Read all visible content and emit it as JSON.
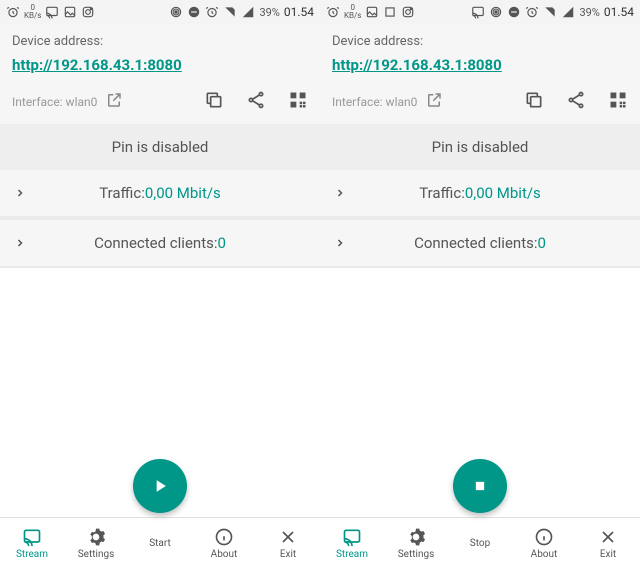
{
  "colors": {
    "accent": "#009688"
  },
  "left": {
    "status": {
      "kbs_value": "0",
      "kbs_unit": "KB/s",
      "battery": "39%",
      "time": "01.54"
    },
    "address": {
      "label": "Device address:",
      "url": "http://192.168.43.1:8080",
      "interface_label": "Interface: wlan0"
    },
    "pin": "Pin is disabled",
    "traffic": {
      "label": "Traffic: ",
      "value": "0,00 Mbit/s"
    },
    "clients": {
      "label": "Connected clients: ",
      "value": "0"
    },
    "fab": "start",
    "nav": {
      "stream": "Stream",
      "settings": "Settings",
      "center": "Start",
      "about": "About",
      "exit": "Exit"
    }
  },
  "right": {
    "status": {
      "kbs_value": "0",
      "kbs_unit": "KB/s",
      "battery": "39%",
      "time": "01.54"
    },
    "address": {
      "label": "Device address:",
      "url": "http://192.168.43.1:8080",
      "interface_label": "Interface: wlan0"
    },
    "pin": "Pin is disabled",
    "traffic": {
      "label": "Traffic: ",
      "value": "0,00 Mbit/s"
    },
    "clients": {
      "label": "Connected clients: ",
      "value": "0"
    },
    "fab": "stop",
    "nav": {
      "stream": "Stream",
      "settings": "Settings",
      "center": "Stop",
      "about": "About",
      "exit": "Exit"
    }
  }
}
